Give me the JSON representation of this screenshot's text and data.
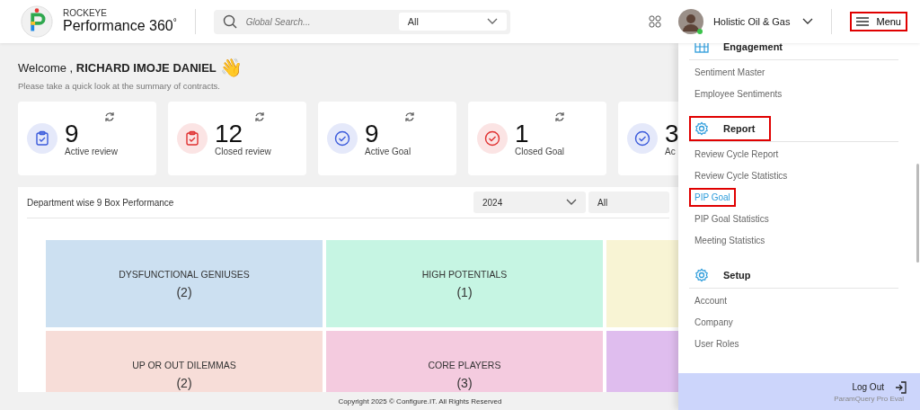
{
  "header": {
    "brand_top": "ROCKEYE",
    "brand_name": "Performance 360",
    "brand_mark": "°",
    "search": {
      "placeholder": "Global Search..."
    },
    "scope": "All",
    "company": "Holistic Oil & Gas",
    "menu_button": {
      "label": "Menu",
      "highlighted": true
    }
  },
  "welcome": {
    "greeting": "Welcome , **RICHARD IMOJE DANIEL**",
    "wave": "👋",
    "subtitle": "Please take a quick look at the summary of contracts."
  },
  "stats": [
    {
      "value": "9",
      "label": "Active review",
      "kind": "review",
      "color": "#3b5bdb"
    },
    {
      "value": "12",
      "label": "Closed review",
      "kind": "review",
      "color": "#e03131"
    },
    {
      "value": "9",
      "label": "Active Goal",
      "kind": "goal",
      "color": "#3b5bdb"
    },
    {
      "value": "1",
      "label": "Closed Goal",
      "kind": "goal",
      "color": "#e03131"
    },
    {
      "value": "3",
      "label": "Ac",
      "kind": "goal",
      "color": "#3b5bdb"
    }
  ],
  "panel": {
    "title": "Department wise 9 Box Performance",
    "year": "2024",
    "filter": "All",
    "cells": [
      {
        "label": "DYSFUNCTIONAL GENIUSES",
        "count": "(2)",
        "color": "#cce0f1"
      },
      {
        "label": "HIGH POTENTIALS",
        "count": "(1)",
        "color": "#c6f5e3"
      },
      {
        "color": "#f8f4d4"
      },
      {
        "label": "UP OR OUT DILEMMAS",
        "count": "(2)",
        "color": "#f7ddd8"
      },
      {
        "label": "CORE PLAYERS",
        "count": "(3)",
        "color": "#f4cbdf"
      },
      {
        "color": "#dfbdee"
      }
    ]
  },
  "footer": "Copyright 2025 © Configure.IT. All Rights Reserved",
  "menu": {
    "sections": [
      {
        "title": "Engagement",
        "kind": "grid",
        "highlighted": false,
        "items": [
          {
            "label": "Sentiment Master",
            "selected": false,
            "highlighted": false
          },
          {
            "label": "Employee Sentiments",
            "selected": false,
            "highlighted": false
          }
        ]
      },
      {
        "title": "Report",
        "kind": "gear",
        "highlighted": true,
        "items": [
          {
            "label": "Review Cycle Report",
            "selected": false,
            "highlighted": false
          },
          {
            "label": "Review Cycle Statistics",
            "selected": false,
            "highlighted": false
          },
          {
            "label": "PIP Goal",
            "selected": true,
            "highlighted": true
          },
          {
            "label": "PIP Goal Statistics",
            "selected": false,
            "highlighted": false
          },
          {
            "label": "Meeting Statistics",
            "selected": false,
            "highlighted": false
          }
        ]
      },
      {
        "title": "Setup",
        "kind": "gear",
        "highlighted": false,
        "items": [
          {
            "label": "Account",
            "selected": false,
            "highlighted": false
          },
          {
            "label": "Company",
            "selected": false,
            "highlighted": false
          },
          {
            "label": "User Roles",
            "selected": false,
            "highlighted": false
          }
        ]
      }
    ],
    "logout": "Log Out",
    "eval_note": "ParamQuery Pro Eval"
  }
}
